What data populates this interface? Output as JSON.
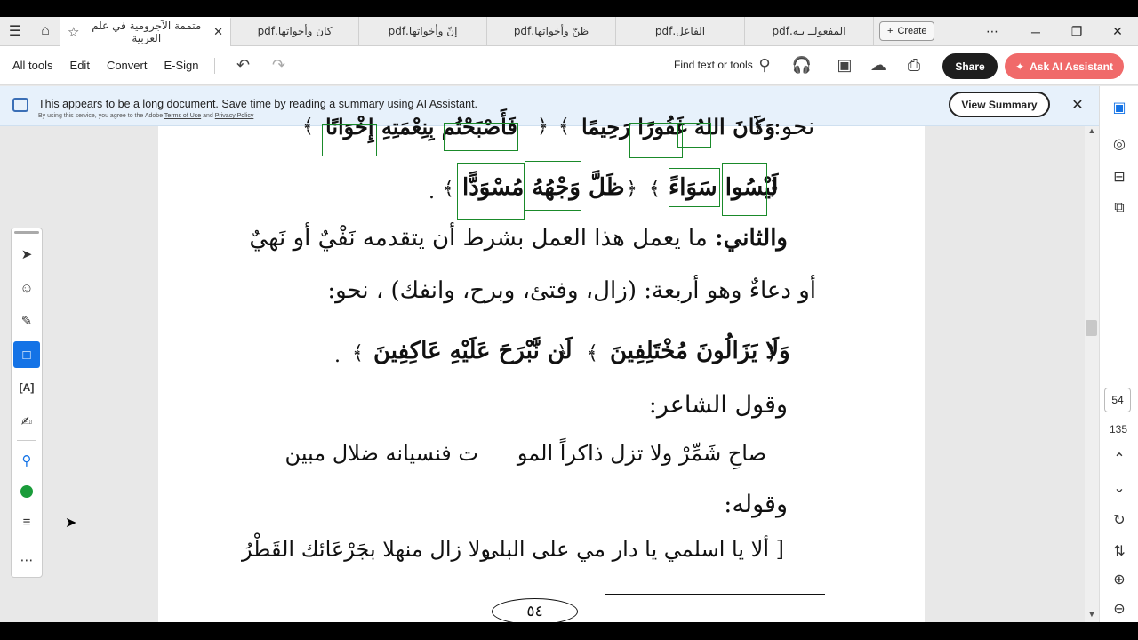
{
  "tabs": [
    {
      "label": "متممة الآجرومية في علم العربية",
      "active": true
    },
    {
      "label": "كان وأخواتها.pdf"
    },
    {
      "label": "إنّ وأخواتها.pdf"
    },
    {
      "label": "ظنّ وأخواتها.pdf"
    },
    {
      "label": "الفاعل.pdf"
    },
    {
      "label": "المفعولــ بـه.pdf"
    }
  ],
  "create_label": "Create",
  "menu": {
    "all_tools": "All tools",
    "edit": "Edit",
    "convert": "Convert",
    "esign": "E-Sign"
  },
  "find_label": "Find text or tools",
  "share_label": "Share",
  "ai_label": "Ask AI Assistant",
  "banner": {
    "main": "This appears to be a long document. Save time by reading a summary using AI Assistant.",
    "sub_prefix": "By using this service, you agree to the Adobe",
    "terms": "Terms of Use",
    "and": "and",
    "privacy": "Privacy Policy",
    "view_summary": "View Summary"
  },
  "page": {
    "current": "54",
    "total": "135"
  },
  "doc": {
    "line1_prefix": "نحو:",
    "line1_verse1": "وَكَانَ اللهُ غَفُورًا رَحِيمًا",
    "line1_verse2": "فَأَصْبَحْتُم بِنِعْمَتِهِ إِخْوَانًا",
    "line2_verse": "لَيْسُوا سَوَاءً",
    "line2_verse2": "ظَلَّ وَجْهُهُ مُسْوَدًّا",
    "line3_bold": "والثاني:",
    "line3_rest": "ما يعمل هذا العمل بشرط أن يتقدمه نَفْيٌ أو نَهيٌ",
    "line4": "أو دعاءٌ وهو أربعة: (زال، وفتئ، وبرح، وانفك) ، نحو:",
    "verse3": "وَلَا يَزَالُونَ مُخْتَلِفِينَ",
    "verse4": "لَن نَّبْرَحَ عَلَيْهِ عَاكِفِينَ",
    "poet_intro": "وقول الشاعر:",
    "poem1_a": "صاحِ شَمِّرْ ولا تزل ذاكراً المو",
    "poem1_b": "ت فنسيانه ضلال مبين",
    "quote_intro": "وقوله:",
    "poem2_a": "[ ألا يا اسلمي يا دار مي على البلى",
    "poem2_b": "ولا زال منهلا بجَرْعَائك القَطْرُ",
    "page_number": "٥٤"
  },
  "icons": {
    "menu": "hamburger-icon",
    "home": "home-icon",
    "star": "star-icon",
    "close": "close-icon",
    "undo": "undo-icon",
    "redo": "redo-icon",
    "search": "search-icon",
    "headphones": "headphones-icon",
    "save": "save-icon",
    "upload": "cloud-upload-icon",
    "print": "print-icon"
  },
  "colors": {
    "accent": "#1473e6",
    "ai": "#f06a6a",
    "banner": "#e7f1fb",
    "highlight_box": "#1a8a2a"
  }
}
